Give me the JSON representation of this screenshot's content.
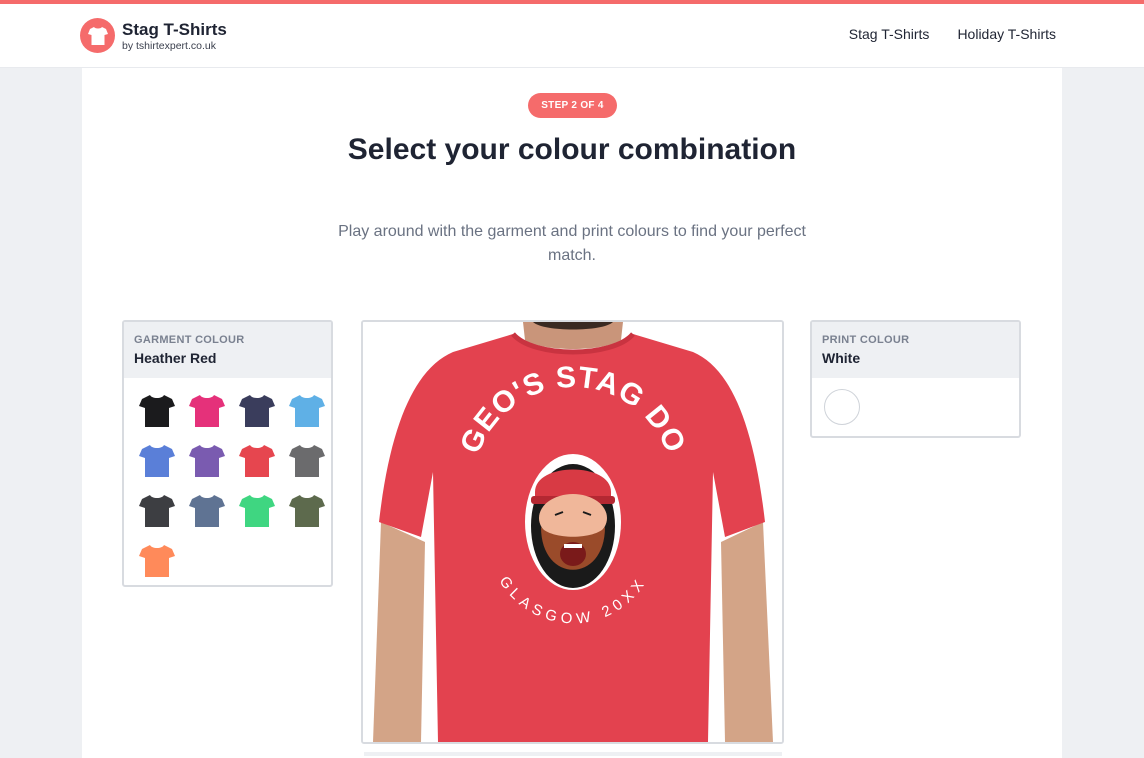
{
  "header": {
    "brand_name": "Stag T-Shirts",
    "brand_sub": "by tshirtexpert.co.uk",
    "nav": [
      "Stag T-Shirts",
      "Holiday T-Shirts"
    ],
    "accent": "#f56b6b"
  },
  "step": {
    "label": "STEP 2 OF 4"
  },
  "heading": {
    "title": "Select your colour combination",
    "subtitle": "Play around with the garment and print colours to find your perfect match."
  },
  "garment": {
    "label": "GARMENT COLOUR",
    "selected": "Heather Red",
    "swatches": [
      {
        "color": "#1b1b1d"
      },
      {
        "color": "#e5317a"
      },
      {
        "color": "#3a3d5c"
      },
      {
        "color": "#5fb0e6"
      },
      {
        "color": "#5a7fd8"
      },
      {
        "color": "#7a5bb0"
      },
      {
        "color": "#e6464f"
      },
      {
        "color": "#6b6b6d"
      },
      {
        "color": "#3d3e42"
      },
      {
        "color": "#5f7393"
      },
      {
        "color": "#3fd681"
      },
      {
        "color": "#5d6a4d"
      },
      {
        "color": "#ff8a5a"
      }
    ]
  },
  "print": {
    "label": "PRINT COLOUR",
    "selected": "White",
    "swatch_color": "#ffffff"
  },
  "preview": {
    "shirt_color": "#e3424f",
    "print_text_top": "GEO'S STAG DO",
    "print_text_bottom": "GLASGOW 20XX"
  }
}
